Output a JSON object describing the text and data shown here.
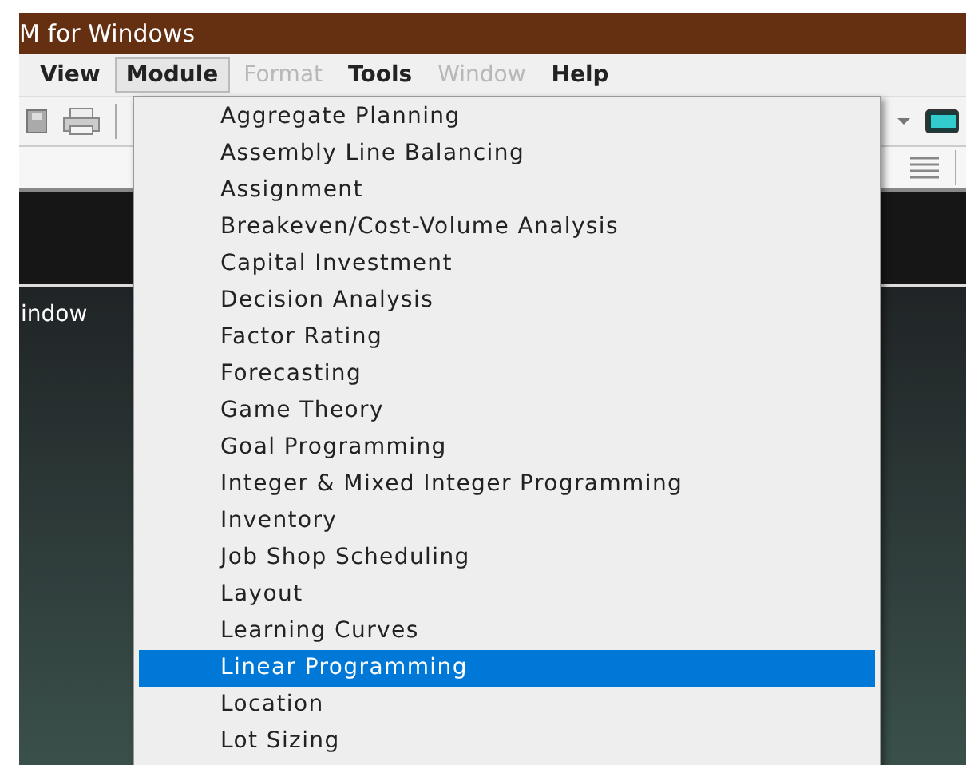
{
  "window": {
    "title": "M for Windows"
  },
  "menu_bar": [
    {
      "label": "View",
      "selected": false,
      "disabled": false
    },
    {
      "label": "Module",
      "selected": true,
      "disabled": false
    },
    {
      "label": "Format",
      "selected": false,
      "disabled": true
    },
    {
      "label": "Tools",
      "selected": false,
      "disabled": false
    },
    {
      "label": "Window",
      "selected": false,
      "disabled": true
    },
    {
      "label": "Help",
      "selected": false,
      "disabled": false
    }
  ],
  "background_text": "indow",
  "module_menu": [
    {
      "label": "Aggregate Planning",
      "selected": false
    },
    {
      "label": "Assembly Line Balancing",
      "selected": false
    },
    {
      "label": "Assignment",
      "selected": false
    },
    {
      "label": "Breakeven/Cost-Volume Analysis",
      "selected": false
    },
    {
      "label": "Capital Investment",
      "selected": false
    },
    {
      "label": "Decision Analysis",
      "selected": false
    },
    {
      "label": "Factor Rating",
      "selected": false
    },
    {
      "label": "Forecasting",
      "selected": false
    },
    {
      "label": "Game Theory",
      "selected": false
    },
    {
      "label": "Goal Programming",
      "selected": false
    },
    {
      "label": "Integer & Mixed Integer Programming",
      "selected": false
    },
    {
      "label": "Inventory",
      "selected": false
    },
    {
      "label": "Job Shop Scheduling",
      "selected": false
    },
    {
      "label": "Layout",
      "selected": false
    },
    {
      "label": "Learning Curves",
      "selected": false
    },
    {
      "label": "Linear Programming",
      "selected": true
    },
    {
      "label": "Location",
      "selected": false
    },
    {
      "label": "Lot Sizing",
      "selected": false
    }
  ]
}
